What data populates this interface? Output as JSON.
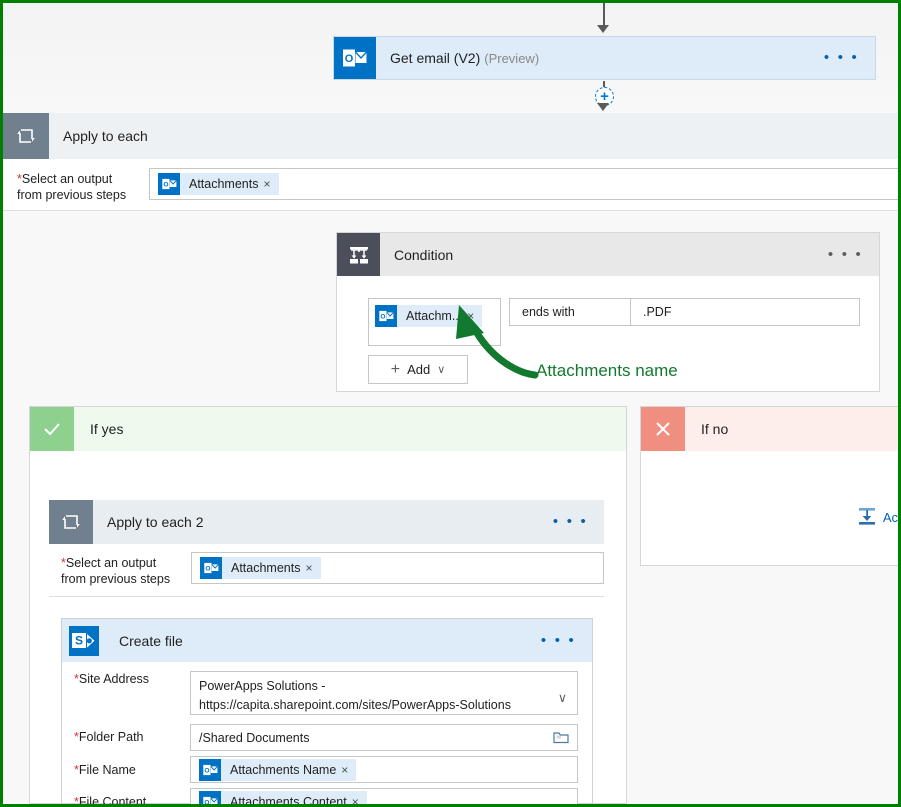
{
  "flow": {
    "get_email": {
      "title": "Get email (V2)",
      "suffix": "(Preview)",
      "icon": "outlook-icon",
      "menu": "• • •"
    },
    "apply_to_each": {
      "title": "Apply to each",
      "icon": "loop-icon",
      "output_label_line1": "Select an output",
      "output_label_line2": "from previous steps",
      "required_marker": "*",
      "token": {
        "label": "Attachments",
        "remove": "×",
        "icon": "outlook-icon"
      }
    },
    "condition": {
      "title": "Condition",
      "icon": "condition-icon",
      "menu": "• • •",
      "left_token": {
        "label": "Attachm...",
        "remove": "×",
        "icon": "outlook-icon"
      },
      "operator": "ends with",
      "operator_chevron": "∨",
      "value": ".PDF",
      "add_button": "Add",
      "add_plus": "+",
      "add_chevron": "∨"
    },
    "annotation": {
      "text": "Attachments name",
      "color": "#127a2e"
    },
    "if_yes": {
      "title": "If yes",
      "icon": "checkmark-icon",
      "header_bg": "#effaef",
      "icon_bg": "#8ed08e"
    },
    "if_no": {
      "title": "If no",
      "icon": "cross-icon",
      "header_bg": "#fdeeec",
      "icon_bg": "#f08e80",
      "add_action_label": "Ac",
      "add_action_icon": "add-action-icon"
    },
    "apply_to_each_2": {
      "title": "Apply to each 2",
      "icon": "loop-icon",
      "menu": "• • •",
      "output_label_line1": "Select an output",
      "output_label_line2": "from previous steps",
      "required_marker": "*",
      "token": {
        "label": "Attachments",
        "remove": "×",
        "icon": "outlook-icon"
      }
    },
    "create_file": {
      "title": "Create file",
      "icon": "sharepoint-icon",
      "menu": "• • •",
      "fields": [
        {
          "label": "Site Address",
          "required": "*",
          "type": "dropdown",
          "value": "PowerApps Solutions - https://capita.sharepoint.com/sites/PowerApps-Solutions",
          "chevron": "∨"
        },
        {
          "label": "Folder Path",
          "required": "*",
          "type": "picker",
          "value": "/Shared Documents",
          "picker_icon": "folder-icon"
        },
        {
          "label": "File Name",
          "required": "*",
          "type": "token",
          "token": {
            "label": "Attachments Name",
            "remove": "×",
            "icon": "outlook-icon"
          }
        },
        {
          "label": "File Content",
          "required": "*",
          "type": "token",
          "token": {
            "label": "Attachments Content",
            "remove": "×",
            "icon": "outlook-icon"
          }
        }
      ]
    }
  },
  "colors": {
    "outlook_blue": "#0072c6",
    "sharepoint_blue": "#0272c5",
    "token_bg": "#deecf9",
    "loop_icon_bg": "#71808f",
    "condition_icon_bg": "#4a4f5a",
    "frame_green": "#008000",
    "annotation_green": "#127a2e",
    "link_blue": "#0063b1"
  }
}
